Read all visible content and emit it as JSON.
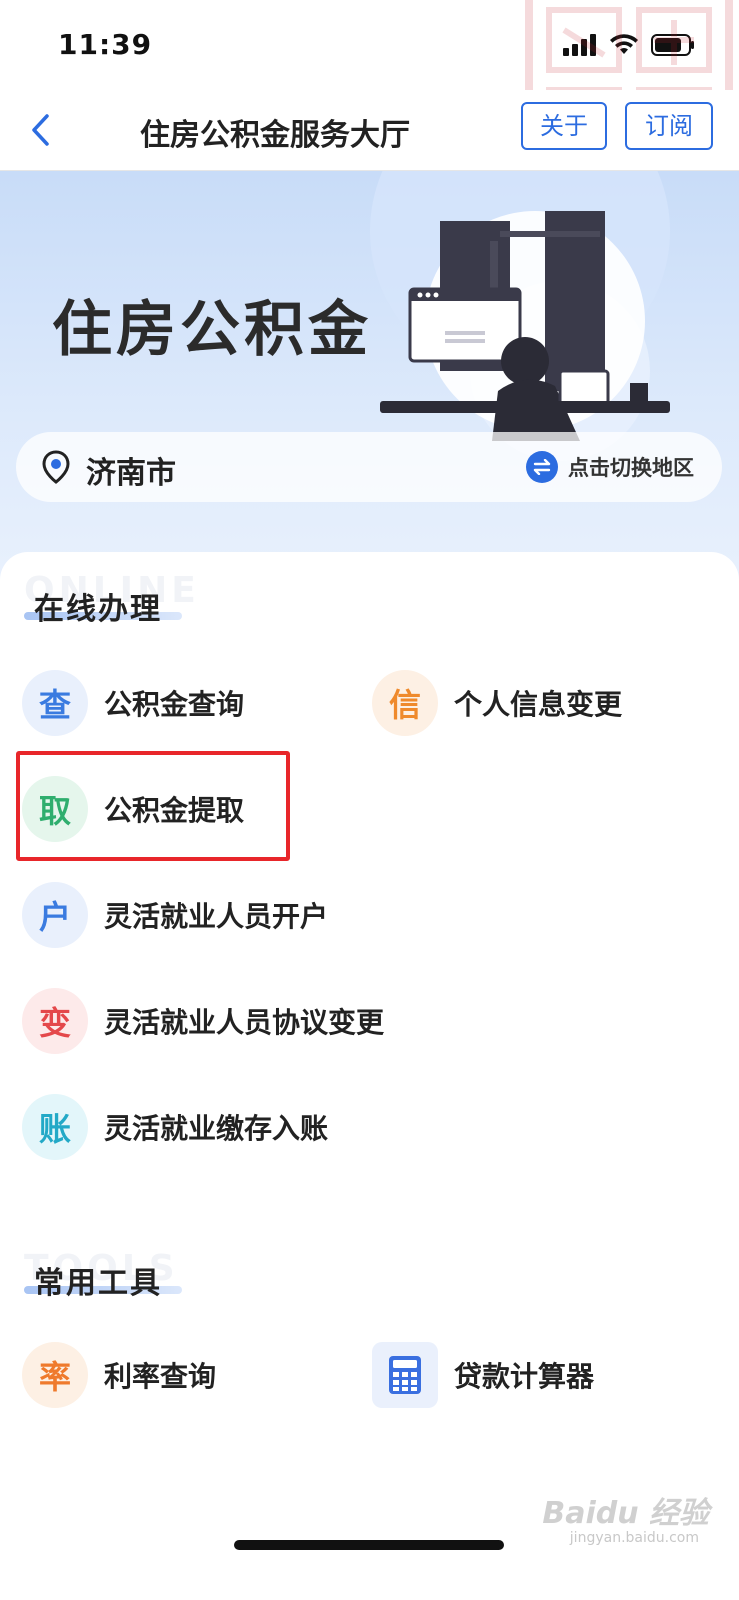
{
  "status": {
    "time": "11:39"
  },
  "nav": {
    "title": "住房公积金服务大厅",
    "about_label": "关于",
    "subscribe_label": "订阅"
  },
  "banner": {
    "title": "住房公积金"
  },
  "location": {
    "city": "济南市",
    "switch_label": "点击切换地区"
  },
  "online": {
    "background_word": "ONLINE",
    "title": "在线办理",
    "items": [
      {
        "icon_char": "查",
        "label": "公积金查询",
        "color": "#3a7be0",
        "bg": "#e9f0fc"
      },
      {
        "icon_char": "信",
        "label": "个人信息变更",
        "color": "#ef8a2c",
        "bg": "#fdf0e4"
      },
      {
        "icon_char": "取",
        "label": "公积金提取",
        "color": "#2fae6e",
        "bg": "#e5f6ec"
      },
      {
        "icon_char": "户",
        "label": "灵活就业人员开户",
        "color": "#3a7be0",
        "bg": "#e9f0fc"
      },
      {
        "icon_char": "变",
        "label": "灵活就业人员协议变更",
        "color": "#e4484b",
        "bg": "#fdeaea"
      },
      {
        "icon_char": "账",
        "label": "灵活就业缴存入账",
        "color": "#22a9c7",
        "bg": "#e3f6fa"
      }
    ]
  },
  "tools": {
    "background_word": "TOOLS",
    "title": "常用工具",
    "items": [
      {
        "icon_char": "率",
        "label": "利率查询",
        "color": "#ef7a2c",
        "bg": "#fdf0e4"
      },
      {
        "icon_name": "calculator-icon",
        "label": "贷款计算器",
        "color": "#3a6fe0",
        "bg": "#eaf0fc"
      }
    ]
  },
  "watermark": {
    "text": "Baidu 经验",
    "sub": "jingyan.baidu.com"
  }
}
